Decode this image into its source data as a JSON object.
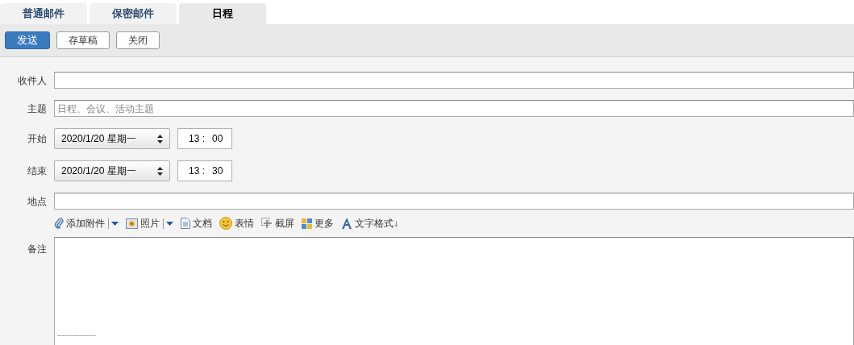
{
  "tabs": [
    {
      "label": "普通邮件",
      "selected": false
    },
    {
      "label": "保密邮件",
      "selected": false
    },
    {
      "label": "日程",
      "selected": true
    }
  ],
  "buttons": [
    {
      "label": "发送",
      "kind": "primary"
    },
    {
      "label": "存草稿",
      "kind": "default"
    },
    {
      "label": "关闭",
      "kind": "default"
    }
  ],
  "form": {
    "recipients": {
      "label": "收件人"
    },
    "subject": {
      "label": "主题",
      "placeholder": "日程、会议、活动主题"
    },
    "start": {
      "label": "开始",
      "date": "2020/1/20 星期一",
      "hour": "13",
      "separator": ":",
      "minute": "00"
    },
    "end": {
      "label": "结束",
      "date": "2020/1/20 星期一",
      "hour": "13",
      "separator": ":",
      "minute": "30"
    },
    "location": {
      "label": "地点"
    },
    "tools": [
      {
        "kind": "attach",
        "label": "添加附件",
        "dropdown": true
      },
      {
        "kind": "photo",
        "label": "照片",
        "dropdown": true
      },
      {
        "kind": "doc",
        "label": "文档",
        "dropdown": false
      },
      {
        "kind": "emoji",
        "label": "表情",
        "dropdown": false
      },
      {
        "kind": "screenshot",
        "label": "截屏",
        "dropdown": false
      },
      {
        "kind": "more",
        "label": "更多",
        "dropdown": false
      },
      {
        "kind": "format",
        "label": "文字格式↓",
        "dropdown": false
      }
    ],
    "notes": {
      "label": "备注",
      "value": "----------------"
    }
  }
}
